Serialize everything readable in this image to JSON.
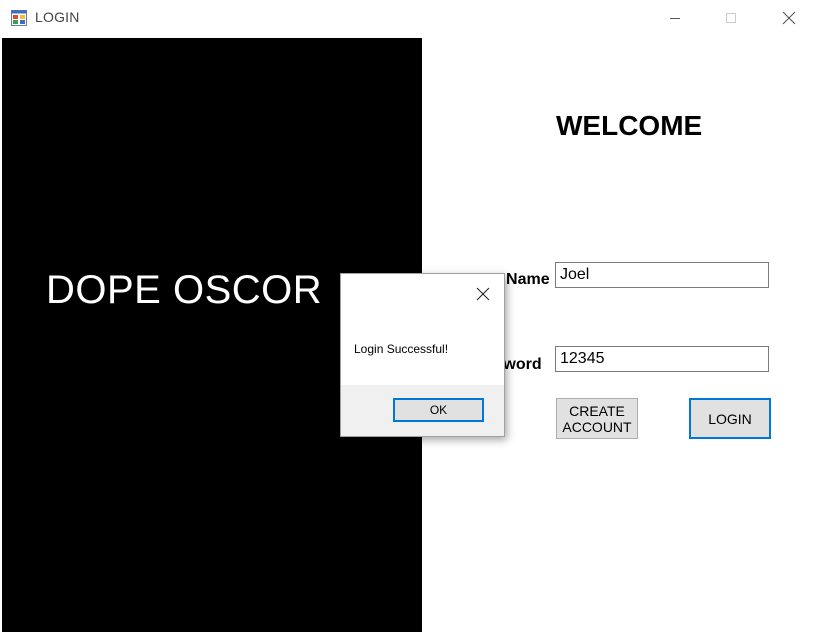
{
  "window": {
    "title": "LOGIN"
  },
  "left_panel": {
    "brand": "DOPE OSCOR"
  },
  "form": {
    "welcome": "WELCOME",
    "username_label": "User Name",
    "username_value": "Joel",
    "password_label": "Password",
    "password_value": "12345",
    "create_account_label": "CREATE\nACCOUNT",
    "login_label": "LOGIN"
  },
  "dialog": {
    "message": "Login Successful!",
    "ok_label": "OK"
  },
  "colors": {
    "accent": "#0078d7",
    "panel": "#000000",
    "button_face": "#e1e1e1"
  },
  "icons": [
    "app-icon",
    "minimize-icon",
    "maximize-icon",
    "close-icon",
    "dialog-close-icon"
  ]
}
